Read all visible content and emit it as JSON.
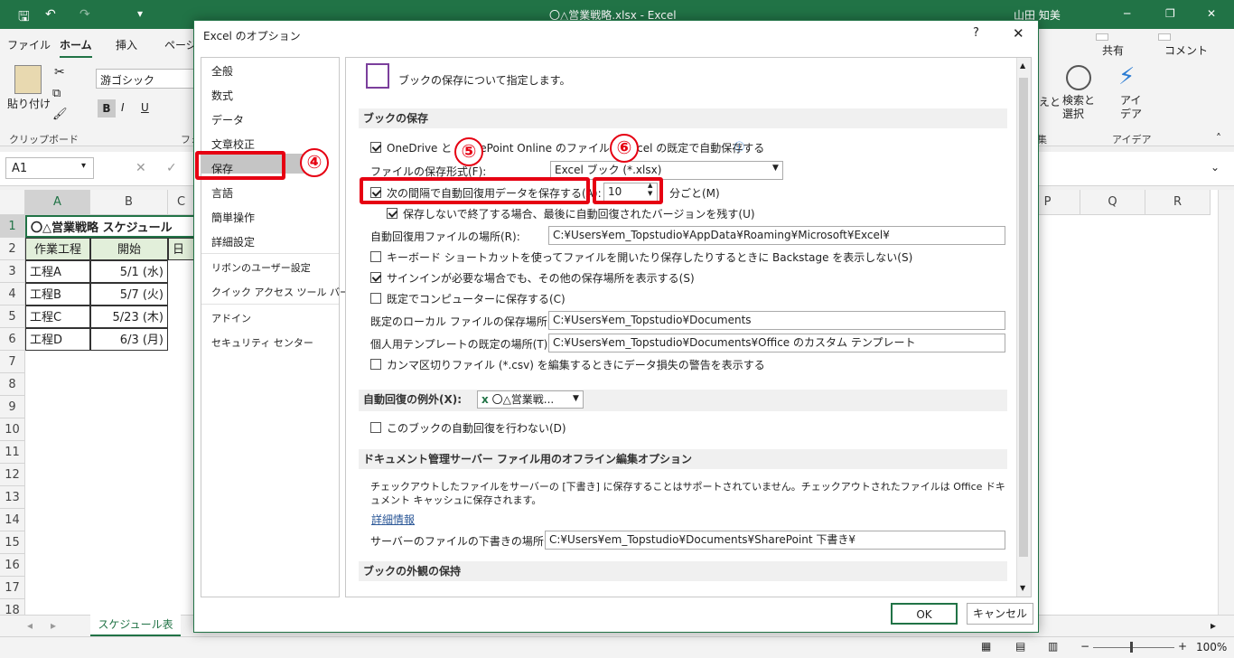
{
  "window": {
    "title": "〇△営業戦略.xlsx  -  Excel",
    "user": "山田 知美"
  },
  "ribbon": {
    "tabs": [
      "ファイル",
      "ホーム",
      "挿入",
      "ページ"
    ],
    "share": "共有",
    "comment": "コメント",
    "paste": "貼り付け",
    "clipboard": "クリップボード",
    "font_group_fragment": "フォ",
    "font_name": "游ゴシック",
    "bold": "B",
    "italic": "I",
    "underline": "U",
    "find_select": "検索と\n選択",
    "sort_fragment": "えと",
    "idea": "アイ\nデア",
    "idea_group": "アイデア",
    "edit_group_fragment": "集"
  },
  "formula_bar": {
    "namebox": "A1"
  },
  "sheet": {
    "columns": [
      "A",
      "B",
      "C",
      "P",
      "Q",
      "R"
    ],
    "rows": [
      "1",
      "2",
      "3",
      "4",
      "5",
      "6",
      "7",
      "8",
      "9",
      "10",
      "11",
      "12",
      "13",
      "14",
      "15",
      "16",
      "17",
      "18"
    ],
    "title": "〇△営業戦略 スケジュール",
    "headers": [
      "作業工程",
      "開始",
      "日"
    ],
    "data": [
      [
        "工程A",
        "5/1 (水)"
      ],
      [
        "工程B",
        "5/7 (火)"
      ],
      [
        "工程C",
        "5/23 (木)"
      ],
      [
        "工程D",
        "6/3 (月)"
      ]
    ],
    "tab": "スケジュール表"
  },
  "status": {
    "zoom": "100%"
  },
  "dialog": {
    "title": "Excel のオプション",
    "help": "?",
    "close": "✕",
    "nav": [
      "全般",
      "数式",
      "データ",
      "文章校正",
      "保存",
      "言語",
      "簡単操作",
      "詳細設定",
      "リボンのユーザー設定",
      "クイック アクセス ツール バー",
      "アドイン",
      "セキュリティ センター"
    ],
    "intro": "ブックの保存について指定します。",
    "sec_save": "ブックの保存",
    "onedrive": "OneDrive と SharePoint Online のファイルを Excel の既定で自動保存する",
    "format_label": "ファイルの保存形式(F):",
    "format_value": "Excel ブック (*.xlsx)",
    "autorecover_label": "次の間隔で自動回復用データを保存する(A):",
    "interval": "10",
    "interval_unit": "分ごと(M)",
    "keep_last": "保存しないで終了する場合、最後に自動回復されたバージョンを残す(U)",
    "ar_location_label": "自動回復用ファイルの場所(R):",
    "ar_location": "C:¥Users¥em_Topstudio¥AppData¥Roaming¥Microsoft¥Excel¥",
    "backstage": "キーボード ショートカットを使ってファイルを開いたり保存したりするときに Backstage を表示しない(S)",
    "signin": "サインインが必要な場合でも、その他の保存場所を表示する(S)",
    "default_pc": "既定でコンピューターに保存する(C)",
    "local_label": "既定のローカル ファイルの保存場所(I):",
    "local_path": "C:¥Users¥em_Topstudio¥Documents",
    "tmpl_label": "個人用テンプレートの既定の場所(T):",
    "tmpl_path": "C:¥Users¥em_Topstudio¥Documents¥Office のカスタム テンプレート",
    "csv": "カンマ区切りファイル (*.csv) を編集するときにデータ損失の警告を表示する",
    "sec_except": "自動回復の例外(X):",
    "except_book": "〇△営業戦...",
    "no_autorecover": "このブックの自動回復を行わない(D)",
    "sec_server": "ドキュメント管理サーバー ファイル用のオフライン編集オプション",
    "server_text": "チェックアウトしたファイルをサーバーの [下書き] に保存することはサポートされていません。チェックアウトされたファイルは Office ドキュメント キャッシュに保存されます。",
    "more_info": "詳細情報",
    "drafts_label": "サーバーのファイルの下書きの場所(V):",
    "drafts_path": "C:¥Users¥em_Topstudio¥Documents¥SharePoint 下書き¥",
    "sec_appearance": "ブックの外観の保持",
    "ok": "OK",
    "cancel": "キャンセル"
  },
  "annotations": {
    "n4": "④",
    "n5": "⑤",
    "n6": "⑥"
  },
  "colors": {
    "excel_green": "#217346",
    "highlight_red": "#e60012",
    "nav_selected": "#c5c5c5"
  }
}
